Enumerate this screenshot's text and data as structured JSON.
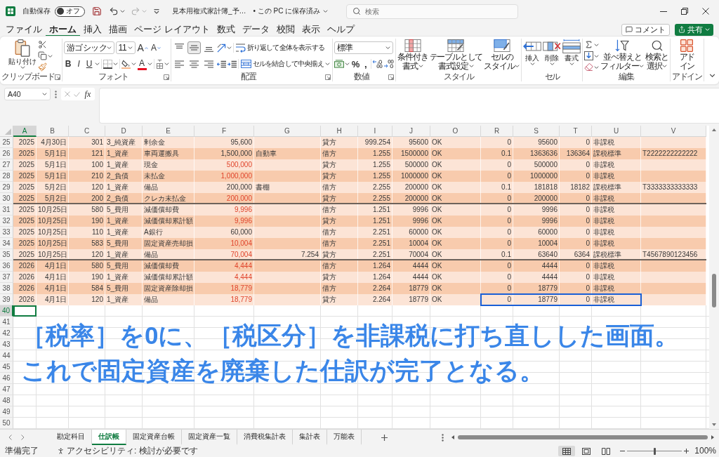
{
  "title_bar": {
    "autosave_label": "自動保存",
    "autosave": {
      "on": false,
      "label": "オフ"
    },
    "undo": {
      "disabled": false
    },
    "redo": {
      "disabled": true
    },
    "file_name": "見本用複式家計簿_予…",
    "save_status": "• この PC に保存済み",
    "search": {
      "placeholder": "検索"
    }
  },
  "menu": {
    "tabs": [
      {
        "label": "ファイル",
        "selected": false
      },
      {
        "label": "ホーム",
        "selected": true
      },
      {
        "label": "挿入",
        "selected": false
      },
      {
        "label": "描画",
        "selected": false
      },
      {
        "label": "ページ レイアウト",
        "selected": false
      },
      {
        "label": "数式",
        "selected": false
      },
      {
        "label": "データ",
        "selected": false
      },
      {
        "label": "校閲",
        "selected": false
      },
      {
        "label": "表示",
        "selected": false
      },
      {
        "label": "ヘルプ",
        "selected": false
      }
    ],
    "comment_button": "コメント",
    "share_button": "共有"
  },
  "ribbon": {
    "clipboard": {
      "paste": "貼り付け",
      "label": "クリップボード"
    },
    "font": {
      "font_name": "游ゴシック",
      "font_size": "11",
      "grow": "A",
      "shrink": "A",
      "bold": "B",
      "italic": "I",
      "underline": "U",
      "font_color": "A",
      "label": "フォント"
    },
    "alignment": {
      "vertical": [
        {
          "selected": false
        },
        {
          "selected": true
        },
        {
          "selected": false
        }
      ],
      "wrap_text": "折り返して全体を表示する",
      "merge": "セルを結合して中央揃え",
      "label": "配置"
    },
    "number": {
      "format": "標準",
      "percent": "%",
      "comma": ",",
      "label": "数値"
    },
    "styles": {
      "buttons": [
        [
          "条件付き",
          "書式"
        ],
        [
          "テーブルとして",
          "書式設定"
        ],
        [
          "セルの",
          "スタイル"
        ]
      ],
      "label": "スタイル"
    },
    "cells": {
      "buttons": [
        "挿入",
        "削除",
        "書式"
      ],
      "label": "セル"
    },
    "editing": {
      "sort_filter": [
        "並べ替えと",
        "フィルター"
      ],
      "find_select": [
        "検索と",
        "選択"
      ],
      "label": "編集"
    },
    "addins": {
      "button": [
        "アド",
        "イン"
      ],
      "label": "アドイン"
    }
  },
  "formula_bar": {
    "name_box": "A40",
    "function_label": "fx"
  },
  "sheet": {
    "columns": [
      {
        "label": "A",
        "selected": true
      },
      {
        "label": "B",
        "selected": false
      },
      {
        "label": "C",
        "selected": false
      },
      {
        "label": "D",
        "selected": false
      },
      {
        "label": "E",
        "selected": false
      },
      {
        "label": "F",
        "selected": false
      },
      {
        "label": "G",
        "selected": false
      },
      {
        "label": "H",
        "selected": false
      },
      {
        "label": "I",
        "selected": false
      },
      {
        "label": "J",
        "selected": false
      },
      {
        "label": "O",
        "selected": false
      },
      {
        "label": "R",
        "selected": false
      },
      {
        "label": "S",
        "selected": false
      },
      {
        "label": "T",
        "selected": false
      },
      {
        "label": "U",
        "selected": false
      },
      {
        "label": "V",
        "selected": false
      }
    ],
    "rows": [
      {
        "number": "25",
        "cells": [
          "2025",
          "4月30日",
          "301",
          "3_純資産",
          "剰余金",
          "95,600",
          null,
          "貸方",
          "999.254",
          "95600",
          "OK",
          "0",
          "95600",
          "0",
          "非課税",
          null
        ],
        "F_red": false,
        "rule_below": false,
        "framed": false
      },
      {
        "number": "26",
        "cells": [
          "2025",
          "5月1日",
          "121",
          "1_資産",
          "車両運搬具",
          "1,500,000",
          "自動車",
          "借方",
          "1.255",
          "1500000",
          "OK",
          "0.1",
          "1363636",
          "136364",
          "課税標準",
          "T2222222222222"
        ],
        "F_red": false,
        "G_number": false,
        "rule_below": false,
        "framed": false
      },
      {
        "number": "27",
        "cells": [
          "2025",
          "5月1日",
          "100",
          "1_資産",
          "現金",
          "500,000",
          null,
          "貸方",
          "1.255",
          "500000",
          "OK",
          "0",
          "500000",
          "0",
          "非課税",
          null
        ],
        "F_red": true,
        "rule_below": false,
        "framed": false
      },
      {
        "number": "28",
        "cells": [
          "2025",
          "5月1日",
          "210",
          "2_負債",
          "未払金",
          "1,000,000",
          null,
          "貸方",
          "1.255",
          "1000000",
          "OK",
          "0",
          "1000000",
          "0",
          "非課税",
          null
        ],
        "F_red": true,
        "rule_below": false,
        "framed": false
      },
      {
        "number": "29",
        "cells": [
          "2025",
          "5月2日",
          "120",
          "1_資産",
          "備品",
          "200,000",
          "書棚",
          "借方",
          "2.255",
          "200000",
          "OK",
          "0.1",
          "181818",
          "18182",
          "課税標準",
          "T3333333333333"
        ],
        "F_red": false,
        "G_number": false,
        "rule_below": false,
        "framed": false
      },
      {
        "number": "30",
        "cells": [
          "2025",
          "5月2日",
          "200",
          "2_負債",
          "クレカ未払金",
          "200,000",
          null,
          "貸方",
          "2.255",
          "200000",
          "OK",
          "0",
          "200000",
          "0",
          "非課税",
          null
        ],
        "F_red": true,
        "rule_below": true,
        "framed": false
      },
      {
        "number": "31",
        "cells": [
          "2025",
          "10月25日",
          "580",
          "5_費用",
          "減価償却費",
          "9,996",
          null,
          "借方",
          "1.251",
          "9996",
          "OK",
          "0",
          "9996",
          "0",
          "非課税",
          null
        ],
        "F_red": true,
        "rule_below": false,
        "framed": false
      },
      {
        "number": "32",
        "cells": [
          "2025",
          "10月25日",
          "190",
          "1_資産",
          "減価償却累計額",
          "9,996",
          null,
          "貸方",
          "1.251",
          "9996",
          "OK",
          "0",
          "9996",
          "0",
          "非課税",
          null
        ],
        "F_red": true,
        "rule_below": false,
        "framed": false
      },
      {
        "number": "33",
        "cells": [
          "2025",
          "10月25日",
          "110",
          "1_資産",
          "A銀行",
          "60,000",
          null,
          "借方",
          "2.251",
          "60000",
          "OK",
          "0",
          "60000",
          "0",
          "非課税",
          null
        ],
        "F_red": false,
        "rule_below": false,
        "framed": false
      },
      {
        "number": "34",
        "cells": [
          "2025",
          "10月25日",
          "583",
          "5_費用",
          "固定資産売却損",
          "10,004",
          null,
          "借方",
          "2.251",
          "10004",
          "OK",
          "0",
          "10004",
          "0",
          "非課税",
          null
        ],
        "F_red": true,
        "rule_below": false,
        "framed": false
      },
      {
        "number": "35",
        "cells": [
          "2025",
          "10月25日",
          "120",
          "1_資産",
          "備品",
          "70,004",
          "7.254",
          "貸方",
          "2.251",
          "70004",
          "OK",
          "0.1",
          "63640",
          "6364",
          "課税標準",
          "T4567890123456"
        ],
        "F_red": true,
        "G_number": true,
        "rule_below": true,
        "framed": false
      },
      {
        "number": "36",
        "cells": [
          "2026",
          "4月1日",
          "580",
          "5_費用",
          "減価償却費",
          "4,444",
          null,
          "借方",
          "1.264",
          "4444",
          "OK",
          "0",
          "4444",
          "0",
          "非課税",
          null
        ],
        "F_red": true,
        "rule_below": false,
        "framed": false
      },
      {
        "number": "37",
        "cells": [
          "2026",
          "4月1日",
          "190",
          "1_資産",
          "減価償却累計額",
          "4,444",
          null,
          "貸方",
          "1.264",
          "4444",
          "OK",
          "0",
          "4444",
          "0",
          "非課税",
          null
        ],
        "F_red": true,
        "rule_below": false,
        "framed": false
      },
      {
        "number": "38",
        "cells": [
          "2026",
          "4月1日",
          "584",
          "5_費用",
          "固定資産除却損",
          "18,779",
          null,
          "借方",
          "2.264",
          "18779",
          "OK",
          "0",
          "18779",
          "0",
          "非課税",
          null
        ],
        "F_red": true,
        "rule_below": false,
        "framed": false
      },
      {
        "number": "39",
        "cells": [
          "2026",
          "4月1日",
          "120",
          "1_資産",
          "備品",
          "18,779",
          null,
          "貸方",
          "2.264",
          "18779",
          "OK",
          "0",
          "18779",
          "0",
          "非課税",
          null
        ],
        "F_red": true,
        "rule_below": false,
        "framed": true
      }
    ],
    "blank_rows": [
      {
        "number": "40",
        "selected": true
      },
      {
        "number": "41",
        "selected": false
      },
      {
        "number": "42",
        "selected": false
      },
      {
        "number": "43",
        "selected": false
      },
      {
        "number": "44",
        "selected": false
      },
      {
        "number": "45",
        "selected": false
      },
      {
        "number": "46",
        "selected": false
      },
      {
        "number": "47",
        "selected": false
      },
      {
        "number": "48",
        "selected": false
      },
      {
        "number": "49",
        "selected": false
      },
      {
        "number": "50",
        "selected": false
      }
    ]
  },
  "annotation": [
    "［税率］を0に、［税区分］を非課税に打ち直しした画面。",
    "これで固定資産を廃棄した仕訳が完了となる。"
  ],
  "sheet_tabs": [
    {
      "label": "勘定科目",
      "selected": false
    },
    {
      "label": "仕訳帳",
      "selected": true
    },
    {
      "label": "固定資産台帳",
      "selected": false
    },
    {
      "label": "固定資産一覧",
      "selected": false
    },
    {
      "label": "消費税集計表",
      "selected": false
    },
    {
      "label": "集計表",
      "selected": false
    },
    {
      "label": "万能表",
      "selected": false
    }
  ],
  "status_bar": {
    "status": "準備完了",
    "accessibility": "アクセシビリティ: 検討が必要です",
    "views": [
      {
        "selected": true
      },
      {
        "selected": false
      },
      {
        "selected": false
      }
    ],
    "zoom": {
      "level": 0.5,
      "label": "100%"
    }
  }
}
